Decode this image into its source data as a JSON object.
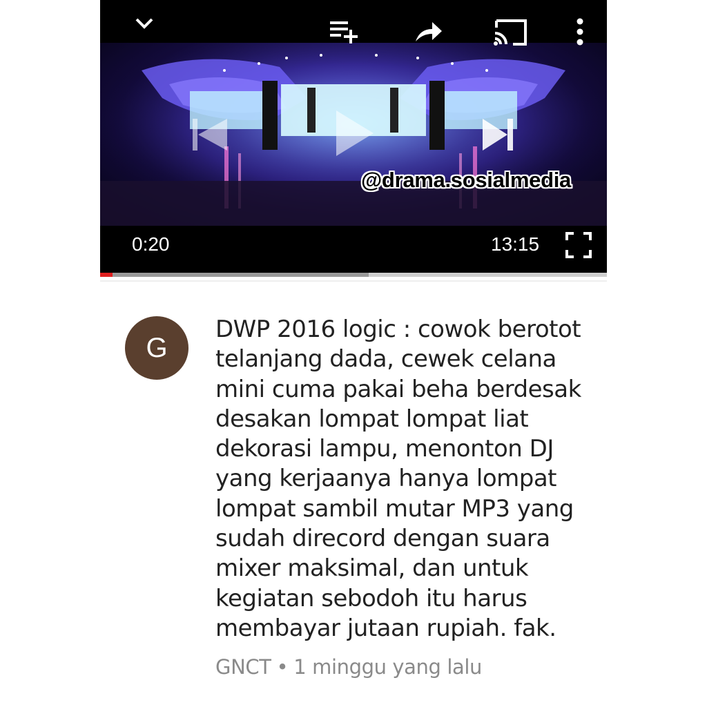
{
  "player": {
    "icons": {
      "collapse": "chevron-down-icon",
      "add_to_playlist": "playlist-add-icon",
      "share": "share-icon",
      "cast": "cast-icon",
      "more": "more-vert-icon",
      "previous": "skip-previous-icon",
      "play": "play-icon",
      "next": "skip-next-icon",
      "fullscreen": "fullscreen-icon"
    },
    "current_time": "0:20",
    "duration": "13:15",
    "progress": {
      "played_fraction": 0.025,
      "buffered_fraction": 0.53
    },
    "colors": {
      "played": "#e02020",
      "buffered": "#9a9a9a",
      "track": "#cfcfcf"
    }
  },
  "watermark": "@drama.sosialmedia",
  "comment": {
    "avatar_letter": "G",
    "avatar_color": "#5a3f2e",
    "text_lines": [
      "DWP 2016 logic : cowok berotot",
      "telanjang dada, cewek celana",
      "mini cuma pakai beha berdesak",
      "desakan lompat lompat liat",
      "dekorasi lampu, menonton DJ",
      "yang kerjaanya hanya lompat",
      "lompat sambil mutar MP3 yang",
      "sudah direcord dengan suara",
      "mixer maksimal, dan untuk",
      "kegiatan sebodoh itu harus",
      "membayar jutaan rupiah. fak."
    ],
    "author": "GNCT",
    "separator": "•",
    "timestamp": "1 minggu yang lalu"
  }
}
